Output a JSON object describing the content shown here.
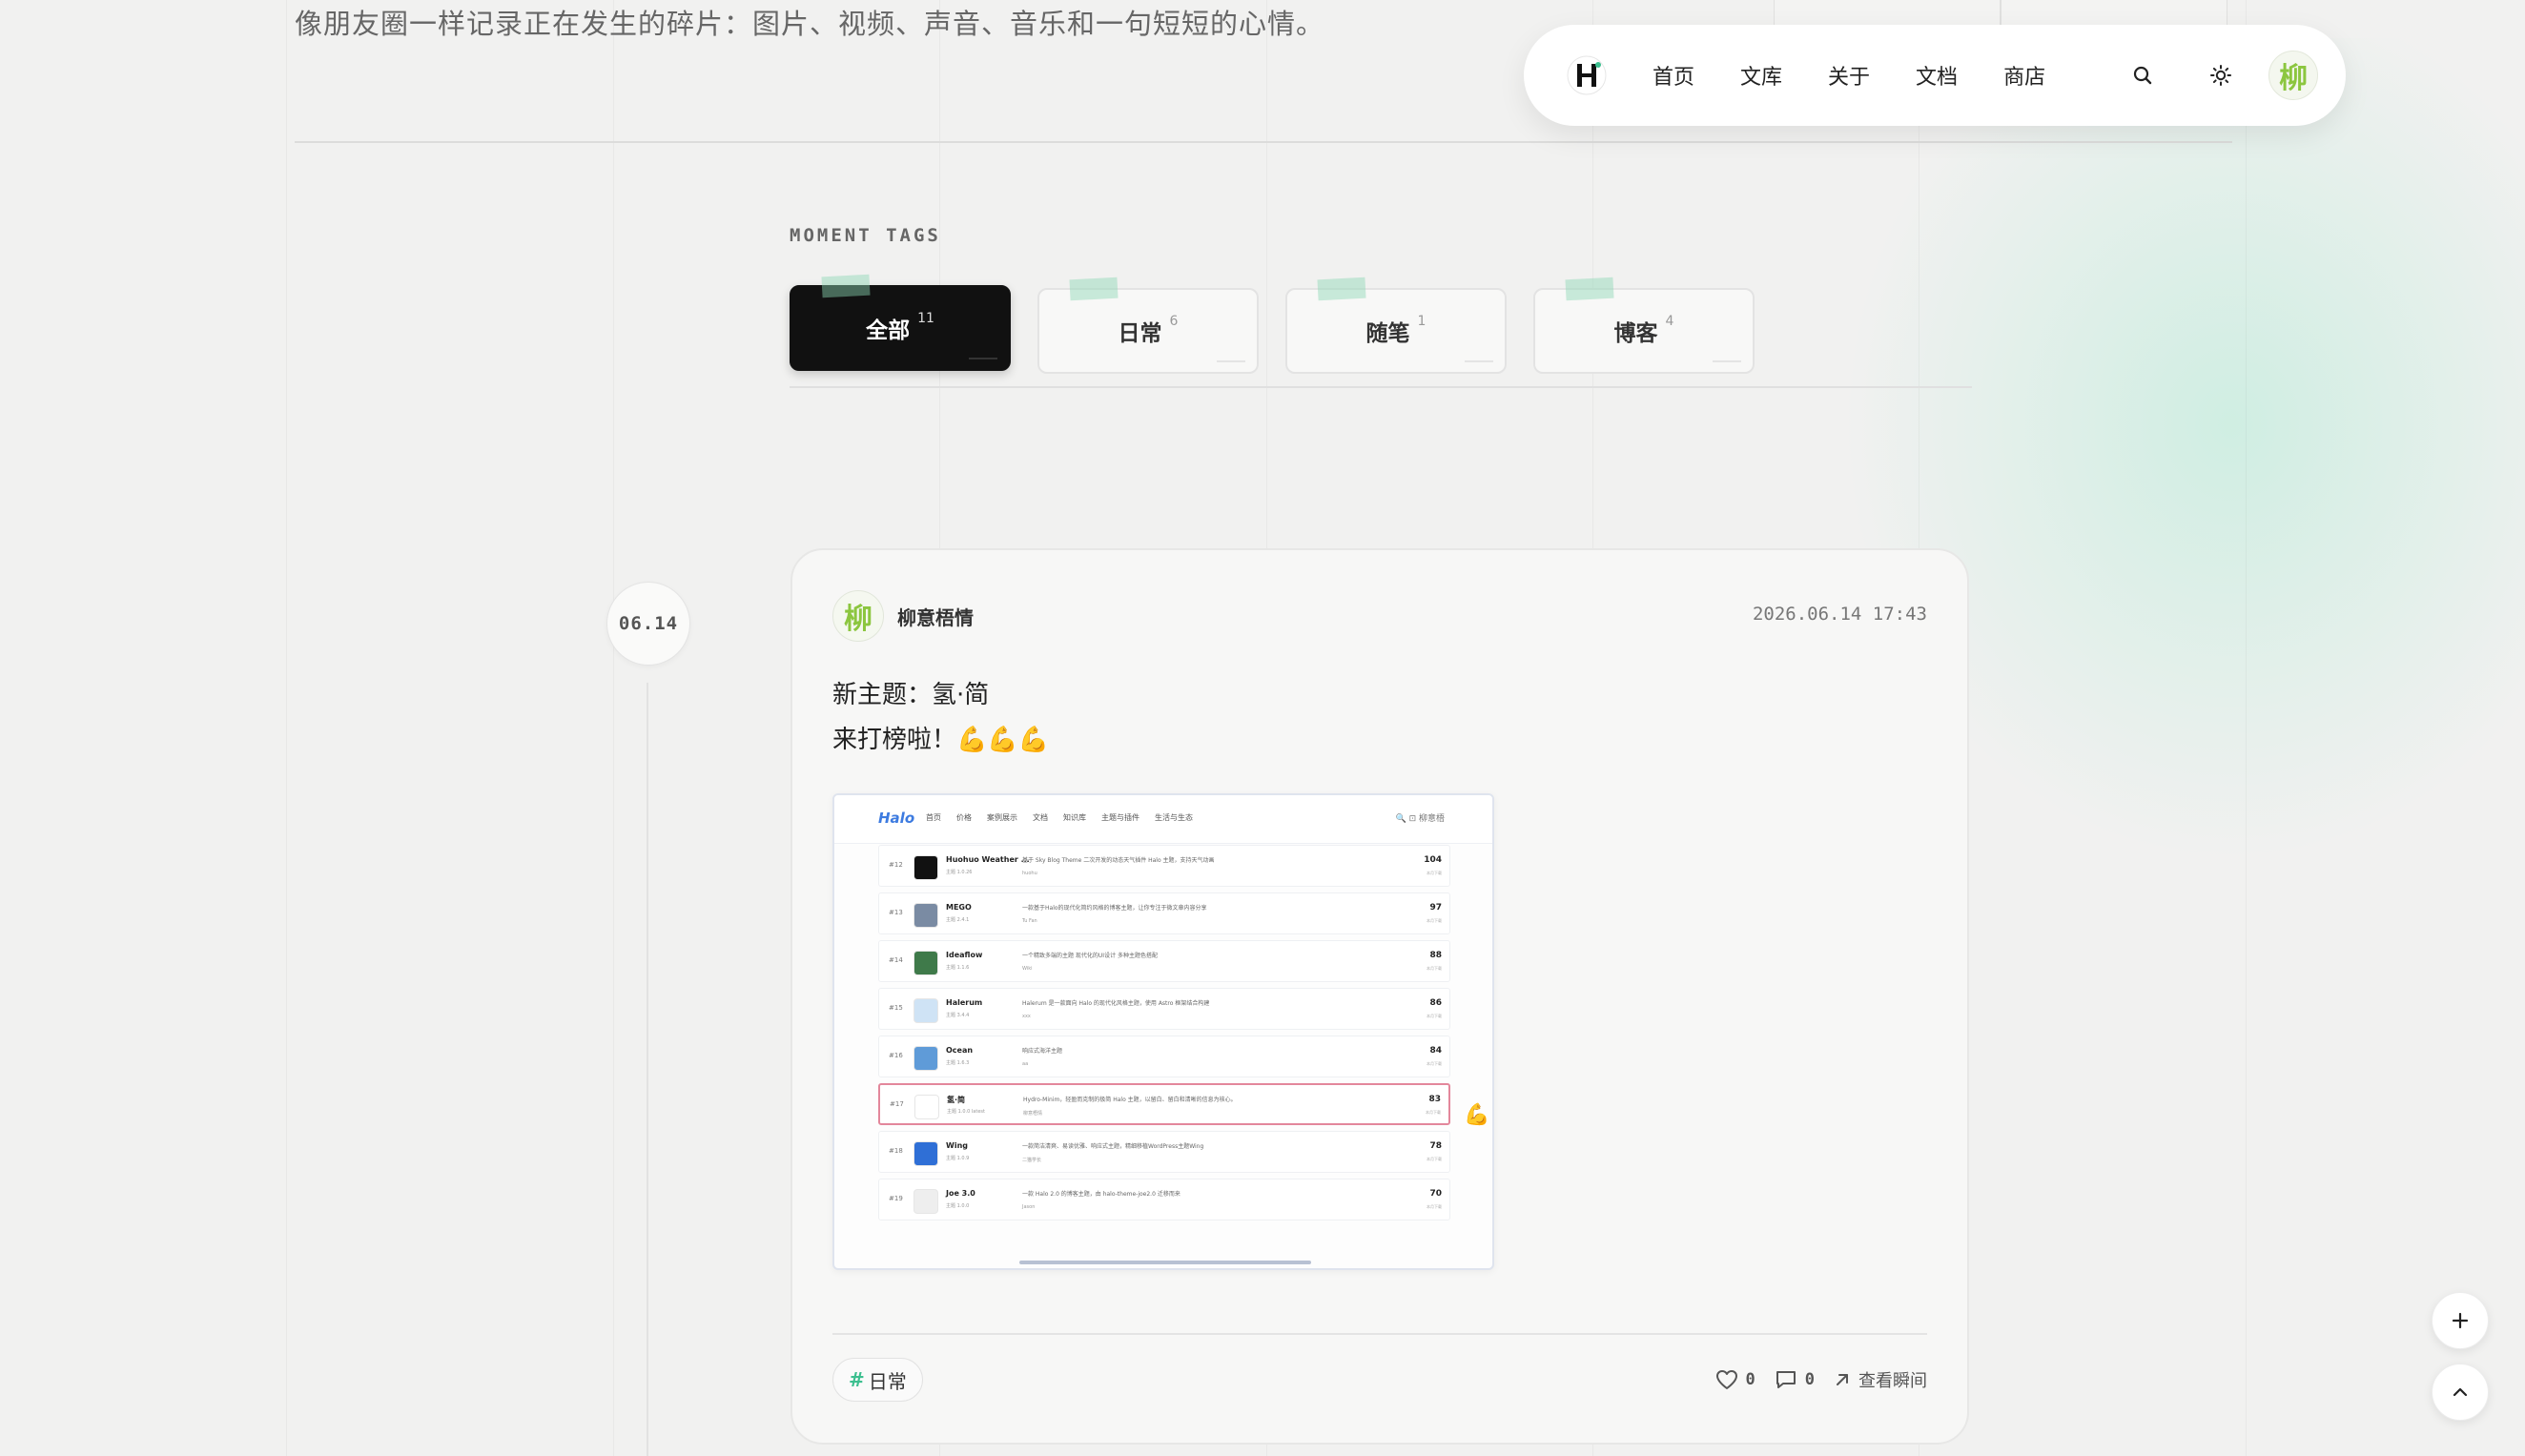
{
  "intro": {
    "subtitle": "像朋友圈一样记录正在发生的碎片：图片、视频、声音、音乐和一句短短的心情。"
  },
  "navbar": {
    "logo_icon": "H-logo-icon",
    "links": [
      "首页",
      "文库",
      "关于",
      "文档",
      "商店"
    ],
    "search_icon": "search-icon",
    "theme_icon": "sun-icon",
    "avatar_text": "柳"
  },
  "tags": {
    "title": "MOMENT TAGS",
    "items": [
      {
        "label": "全部",
        "count": "11",
        "active": true
      },
      {
        "label": "日常",
        "count": "6"
      },
      {
        "label": "随笔",
        "count": "1"
      },
      {
        "label": "博客",
        "count": "4"
      }
    ]
  },
  "timeline": {
    "date": "06.14"
  },
  "moment": {
    "author_avatar": "柳",
    "author": "柳意梧情",
    "time": "2026.06.14 17:43",
    "lines": [
      "新主题：氢·简",
      "来打榜啦！💪💪💪"
    ],
    "screenshot": {
      "logo": "Halo",
      "nav": [
        "首页",
        "价格",
        "案例展示",
        "文档",
        "知识库",
        "主题与插件",
        "生活与生态"
      ],
      "right": "🔍 ⊡ 柳意梧",
      "rows": [
        {
          "rank": "#12",
          "name": "Huohuo Weather ...",
          "ver": "主题 1.0.26",
          "desc": "基于 Sky Blog Theme 二次开发的动态天气插件 Halo 主题，支持天气动画",
          "author": "huohu",
          "score": "104",
          "sub": "本月下载",
          "color": "#111111"
        },
        {
          "rank": "#13",
          "name": "MEGO",
          "ver": "主题 2.4.1",
          "desc": "一款基于Halo的现代化简约风格的博客主题，让你专注于微文章内容分享",
          "author": "Tu Fan",
          "score": "97",
          "sub": "本月下载",
          "color": "#7a8ba3"
        },
        {
          "rank": "#14",
          "name": "Ideaflow",
          "ver": "主题 1.1.6",
          "desc": "一个精致多端的主题 现代化的UI设计 多种主题色搭配",
          "author": "Wiki",
          "score": "88",
          "sub": "本月下载",
          "color": "#3f7a4a"
        },
        {
          "rank": "#15",
          "name": "Halerum",
          "ver": "主题 3.4.4",
          "desc": "Halerum 是一款面向 Halo 的现代化风格主题，使用 Astro 框架结合构建",
          "author": "xxx",
          "score": "86",
          "sub": "本月下载",
          "color": "#cfe3f5"
        },
        {
          "rank": "#16",
          "name": "Ocean",
          "ver": "主题 1.6.3",
          "desc": "响应式海洋主题",
          "author": "aa",
          "score": "84",
          "sub": "本月下载",
          "color": "#5f9bd8"
        },
        {
          "rank": "#17",
          "name": "氢·简",
          "ver": "主题 1.0.0 latest",
          "desc": "Hydro-Minim，轻盈而克制的极简 Halo 主题，以留白、留白和清晰的信息为核心。",
          "author": "柳意梧情",
          "score": "83",
          "sub": "本月下载",
          "color": "#ffffff",
          "highlight": true
        },
        {
          "rank": "#18",
          "name": "Wing",
          "ver": "主题 1.0.9",
          "desc": "一款简洁清爽、易读优雅、响应式主题，精细移植WordPress主题Wing",
          "author": "二猫学长",
          "score": "78",
          "sub": "本月下载",
          "color": "#2f6fd6"
        },
        {
          "rank": "#19",
          "name": "Joe 3.0",
          "ver": "主题 1.0.0",
          "desc": "一款 Halo 2.0 的博客主题，由 halo-theme-joe2.0 迁移而来",
          "author": "Jason",
          "score": "70",
          "sub": "本月下载",
          "color": "#eeeeee"
        }
      ]
    },
    "screenshot_emoji": "💪",
    "tag": "日常",
    "likes": "0",
    "comments": "0",
    "view_label": "查看瞬间"
  },
  "fab": {
    "add_icon": "plus-icon",
    "top_icon": "chevron-up-icon"
  }
}
